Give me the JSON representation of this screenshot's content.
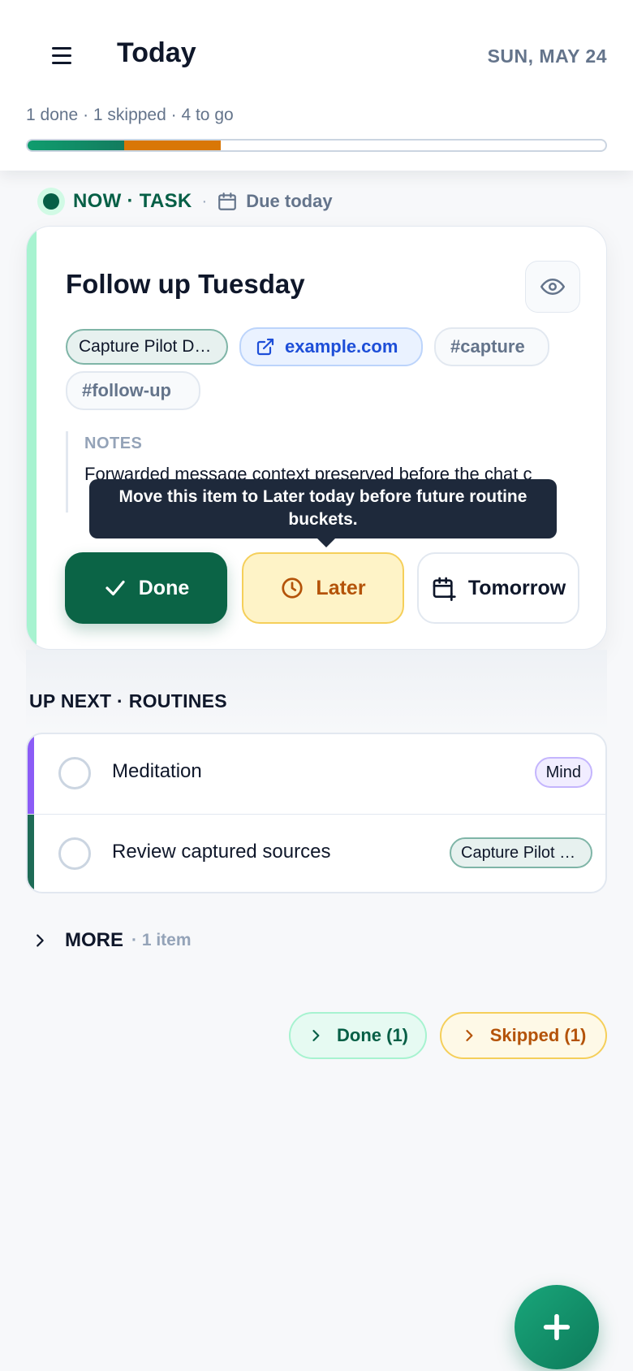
{
  "header": {
    "title": "Today",
    "date": "SUN, MAY 24",
    "summary": "1 done · 1 skipped · 4 to go",
    "progress": {
      "done_fraction": 0.167,
      "skipped_fraction": 0.167
    },
    "colors": {
      "done": "#0f9d6e",
      "skipped": "#d97706"
    }
  },
  "now": {
    "label": "NOW · TASK",
    "separator": "·",
    "due": "Due today"
  },
  "task": {
    "title": "Follow up Tuesday",
    "project_chip": "Capture Pilot D…",
    "link_chip": "example.com",
    "tags": [
      "#capture",
      "#follow-up"
    ],
    "notes_label": "NOTES",
    "notes_text": "Forwarded message context preserved before the chat c",
    "tooltip": "Move this item to Later today before future routine buckets.",
    "actions": {
      "done": "Done",
      "later": "Later",
      "tomorrow": "Tomorrow"
    }
  },
  "routines": {
    "title": "UP NEXT · ROUTINES",
    "items": [
      {
        "label": "Meditation",
        "chip": "Mind",
        "color": "#8b5cf6"
      },
      {
        "label": "Review captured sources",
        "chip": "Capture Pilot …",
        "color": "#1e6b56"
      }
    ]
  },
  "more": {
    "label": "MORE",
    "count": "· 1 item"
  },
  "collapsed": {
    "done": "Done (1)",
    "skipped": "Skipped (1)"
  },
  "icons": [
    "menu-icon",
    "calendar-icon",
    "eye-icon",
    "external-link-icon",
    "check-icon",
    "clock-icon",
    "calendar-plus-icon",
    "chevron-right-icon",
    "plus-icon"
  ]
}
